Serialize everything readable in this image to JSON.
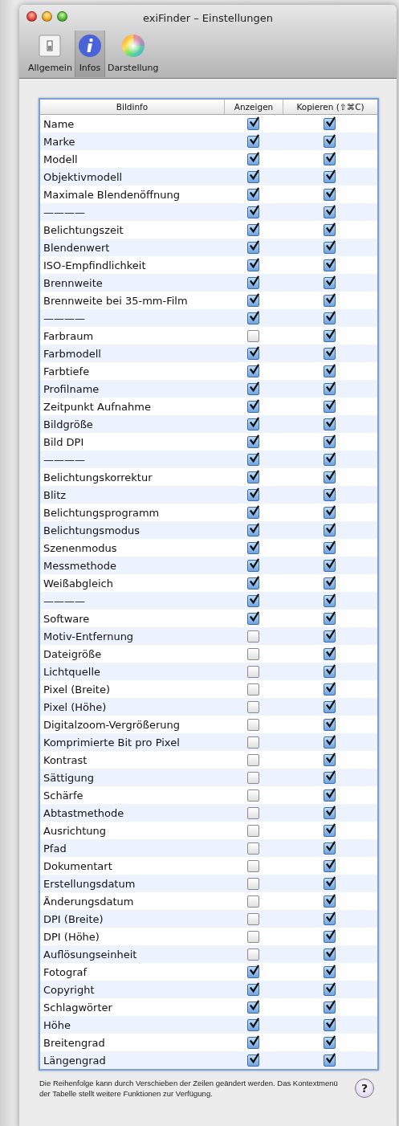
{
  "window": {
    "title": "exiFinder – Einstellungen"
  },
  "toolbar": [
    {
      "label": "Allgemein",
      "selected": false
    },
    {
      "label": "Infos",
      "selected": true
    },
    {
      "label": "Darstellung",
      "selected": false
    }
  ],
  "table": {
    "columns": [
      "Bildinfo",
      "Anzeigen",
      "Kopieren (⇧⌘C)"
    ],
    "rows": [
      {
        "label": "Name",
        "show": true,
        "copy": true
      },
      {
        "label": "Marke",
        "show": true,
        "copy": true
      },
      {
        "label": "Modell",
        "show": true,
        "copy": true
      },
      {
        "label": "Objektivmodell",
        "show": true,
        "copy": true
      },
      {
        "label": "Maximale Blendenöffnung",
        "show": true,
        "copy": true
      },
      {
        "label": "————",
        "show": true,
        "copy": true
      },
      {
        "label": "Belichtungszeit",
        "show": true,
        "copy": true
      },
      {
        "label": "Blendenwert",
        "show": true,
        "copy": true
      },
      {
        "label": "ISO-Empfindlichkeit",
        "show": true,
        "copy": true
      },
      {
        "label": "Brennweite",
        "show": true,
        "copy": true
      },
      {
        "label": "Brennweite bei 35-mm-Film",
        "show": true,
        "copy": true
      },
      {
        "label": "————",
        "show": true,
        "copy": true
      },
      {
        "label": "Farbraum",
        "show": false,
        "copy": true
      },
      {
        "label": "Farbmodell",
        "show": true,
        "copy": true
      },
      {
        "label": "Farbtiefe",
        "show": true,
        "copy": true
      },
      {
        "label": "Profilname",
        "show": true,
        "copy": true
      },
      {
        "label": "Zeitpunkt Aufnahme",
        "show": true,
        "copy": true
      },
      {
        "label": "Bildgröße",
        "show": true,
        "copy": true
      },
      {
        "label": "Bild DPI",
        "show": true,
        "copy": true
      },
      {
        "label": "————",
        "show": true,
        "copy": true
      },
      {
        "label": "Belichtungskorrektur",
        "show": true,
        "copy": true
      },
      {
        "label": "Blitz",
        "show": true,
        "copy": true
      },
      {
        "label": "Belichtungsprogramm",
        "show": true,
        "copy": true
      },
      {
        "label": "Belichtungsmodus",
        "show": true,
        "copy": true
      },
      {
        "label": "Szenenmodus",
        "show": true,
        "copy": true
      },
      {
        "label": "Messmethode",
        "show": true,
        "copy": true
      },
      {
        "label": "Weißabgleich",
        "show": true,
        "copy": true
      },
      {
        "label": "————",
        "show": true,
        "copy": true
      },
      {
        "label": "Software",
        "show": true,
        "copy": true
      },
      {
        "label": "Motiv-Entfernung",
        "show": false,
        "copy": true
      },
      {
        "label": "Dateigröße",
        "show": false,
        "copy": true
      },
      {
        "label": "Lichtquelle",
        "show": false,
        "copy": true
      },
      {
        "label": "Pixel (Breite)",
        "show": false,
        "copy": true
      },
      {
        "label": "Pixel (Höhe)",
        "show": false,
        "copy": true
      },
      {
        "label": "Digitalzoom-Vergrößerung",
        "show": false,
        "copy": true
      },
      {
        "label": "Komprimierte Bit pro Pixel",
        "show": false,
        "copy": true
      },
      {
        "label": "Kontrast",
        "show": false,
        "copy": true
      },
      {
        "label": "Sättigung",
        "show": false,
        "copy": true
      },
      {
        "label": "Schärfe",
        "show": false,
        "copy": true
      },
      {
        "label": "Abtastmethode",
        "show": false,
        "copy": true
      },
      {
        "label": "Ausrichtung",
        "show": false,
        "copy": true
      },
      {
        "label": "Pfad",
        "show": false,
        "copy": true
      },
      {
        "label": "Dokumentart",
        "show": false,
        "copy": true
      },
      {
        "label": "Erstellungsdatum",
        "show": false,
        "copy": true
      },
      {
        "label": "Änderungsdatum",
        "show": false,
        "copy": true
      },
      {
        "label": "DPI (Breite)",
        "show": false,
        "copy": true
      },
      {
        "label": "DPI (Höhe)",
        "show": false,
        "copy": true
      },
      {
        "label": "Auflösungseinheit",
        "show": false,
        "copy": true
      },
      {
        "label": "Fotograf",
        "show": true,
        "copy": true
      },
      {
        "label": "Copyright",
        "show": true,
        "copy": true
      },
      {
        "label": "Schlagwörter",
        "show": true,
        "copy": true
      },
      {
        "label": "Höhe",
        "show": true,
        "copy": true
      },
      {
        "label": "Breitengrad",
        "show": true,
        "copy": true
      },
      {
        "label": "Längengrad",
        "show": true,
        "copy": true
      }
    ]
  },
  "footer": {
    "text": "Die Reihenfolge kann durch Verschieben der Zeilen geändert werden. Das Kontextmenü der Tabelle stellt weitere Funktionen zur Verfügung.",
    "help": "?"
  }
}
